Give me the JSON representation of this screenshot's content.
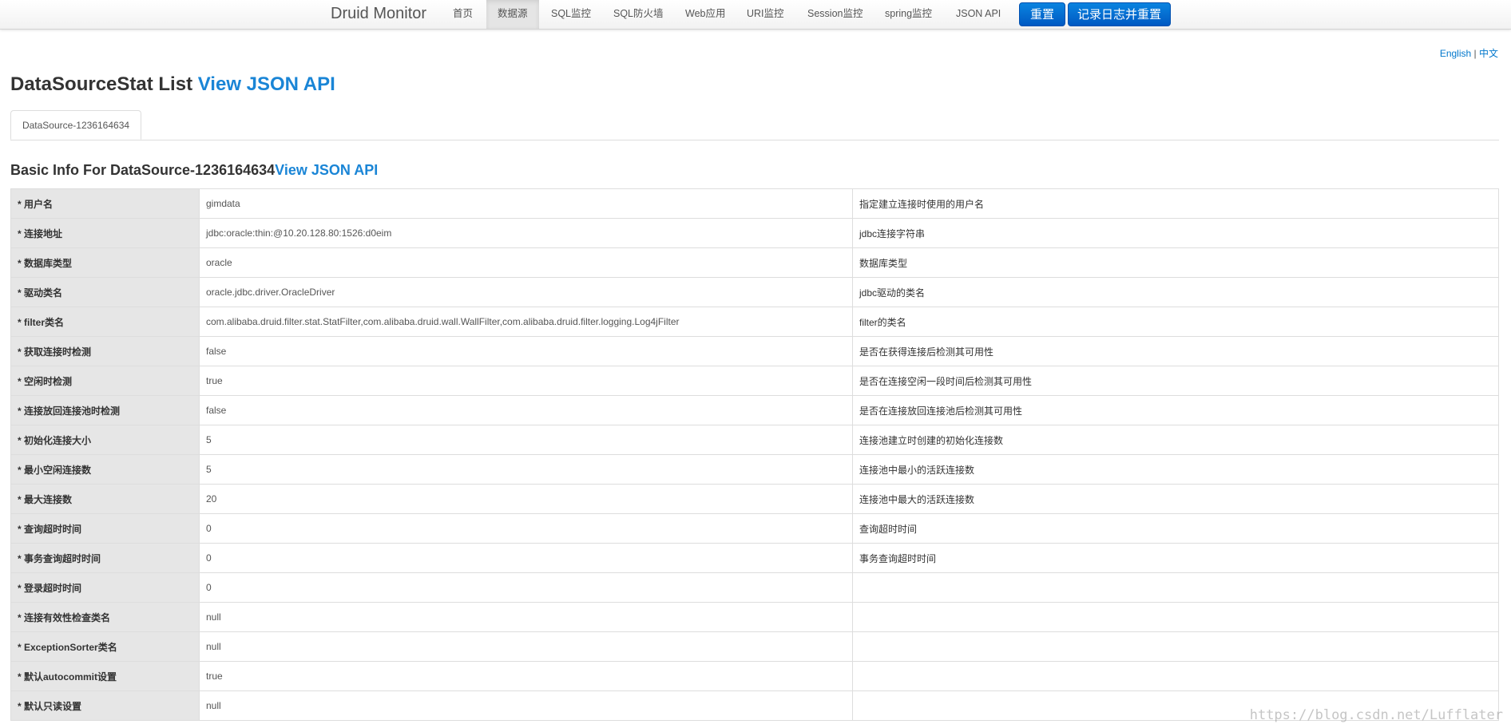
{
  "navbar": {
    "brand": "Druid Monitor",
    "items": [
      {
        "label": "首页",
        "active": false
      },
      {
        "label": "数据源",
        "active": true
      },
      {
        "label": "SQL监控",
        "active": false
      },
      {
        "label": "SQL防火墙",
        "active": false
      },
      {
        "label": "Web应用",
        "active": false
      },
      {
        "label": "URI监控",
        "active": false
      },
      {
        "label": "Session监控",
        "active": false
      },
      {
        "label": "spring监控",
        "active": false
      },
      {
        "label": "JSON API",
        "active": false
      }
    ],
    "reset_button": "重置",
    "log_reset_button": "记录日志并重置"
  },
  "lang": {
    "english": "English",
    "separator": "|",
    "chinese": "中文"
  },
  "page": {
    "title": "DataSourceStat List",
    "title_link": "View JSON API"
  },
  "tabs": [
    "DataSource-1236164634"
  ],
  "section": {
    "title": "Basic Info For DataSource-1236164634",
    "title_link": "View JSON API"
  },
  "rows": [
    {
      "key": "* 用户名",
      "value": "gimdata",
      "desc": "指定建立连接时使用的用户名"
    },
    {
      "key": "* 连接地址",
      "value": "jdbc:oracle:thin:@10.20.128.80:1526:d0eim",
      "desc": "jdbc连接字符串"
    },
    {
      "key": "* 数据库类型",
      "value": "oracle",
      "desc": "数据库类型"
    },
    {
      "key": "* 驱动类名",
      "value": "oracle.jdbc.driver.OracleDriver",
      "desc": "jdbc驱动的类名"
    },
    {
      "key": "* filter类名",
      "value": "com.alibaba.druid.filter.stat.StatFilter,com.alibaba.druid.wall.WallFilter,com.alibaba.druid.filter.logging.Log4jFilter",
      "desc": "filter的类名"
    },
    {
      "key": "* 获取连接时检测",
      "value": "false",
      "desc": "是否在获得连接后检测其可用性"
    },
    {
      "key": "* 空闲时检测",
      "value": "true",
      "desc": "是否在连接空闲一段时间后检测其可用性"
    },
    {
      "key": "* 连接放回连接池时检测",
      "value": "false",
      "desc": "是否在连接放回连接池后检测其可用性"
    },
    {
      "key": "* 初始化连接大小",
      "value": "5",
      "desc": "连接池建立时创建的初始化连接数"
    },
    {
      "key": "* 最小空闲连接数",
      "value": "5",
      "desc": "连接池中最小的活跃连接数"
    },
    {
      "key": "* 最大连接数",
      "value": "20",
      "desc": "连接池中最大的活跃连接数"
    },
    {
      "key": "* 查询超时时间",
      "value": "0",
      "desc": "查询超时时间"
    },
    {
      "key": "* 事务查询超时时间",
      "value": "0",
      "desc": "事务查询超时时间"
    },
    {
      "key": "* 登录超时时间",
      "value": "0",
      "desc": ""
    },
    {
      "key": "* 连接有效性检查类名",
      "value": "null",
      "desc": ""
    },
    {
      "key": "* ExceptionSorter类名",
      "value": "null",
      "desc": ""
    },
    {
      "key": "* 默认autocommit设置",
      "value": "true",
      "desc": ""
    },
    {
      "key": "* 默认只读设置",
      "value": "null",
      "desc": ""
    }
  ],
  "watermark": "https://blog.csdn.net/Lufflater"
}
